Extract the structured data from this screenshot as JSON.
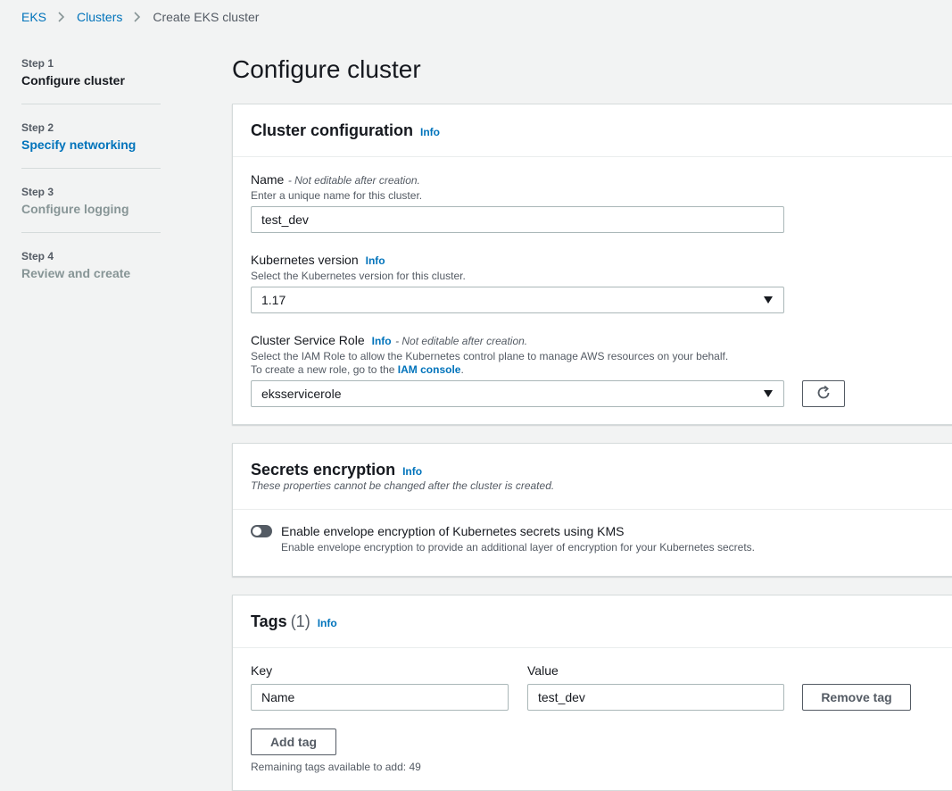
{
  "breadcrumb": {
    "items": [
      "EKS",
      "Clusters"
    ],
    "current": "Create EKS cluster"
  },
  "steps": [
    {
      "step": "Step 1",
      "title": "Configure cluster"
    },
    {
      "step": "Step 2",
      "title": "Specify networking"
    },
    {
      "step": "Step 3",
      "title": "Configure logging"
    },
    {
      "step": "Step 4",
      "title": "Review and create"
    }
  ],
  "page_title": "Configure cluster",
  "cluster_config": {
    "title": "Cluster configuration",
    "info": "Info",
    "name_label": "Name",
    "name_note": "- Not editable after creation.",
    "name_desc": "Enter a unique name for this cluster.",
    "name_value": "test_dev",
    "version_label": "Kubernetes version",
    "version_info": "Info",
    "version_desc": "Select the Kubernetes version for this cluster.",
    "version_value": "1.17",
    "role_label": "Cluster Service Role",
    "role_info": "Info",
    "role_note": "- Not editable after creation.",
    "role_desc1": "Select the IAM Role to allow the Kubernetes control plane to manage AWS resources on your behalf.",
    "role_desc2_prefix": "To create a new role, go to the",
    "role_desc2_link": "IAM console",
    "role_desc2_suffix": ".",
    "role_value": "eksservicerole"
  },
  "secrets": {
    "title": "Secrets encryption",
    "info": "Info",
    "subtitle": "These properties cannot be changed after the cluster is created.",
    "toggle_label": "Enable envelope encryption of Kubernetes secrets using KMS",
    "toggle_desc": "Enable envelope encryption to provide an additional layer of encryption for your Kubernetes secrets."
  },
  "tags": {
    "title": "Tags",
    "count": "(1)",
    "info": "Info",
    "key_label": "Key",
    "value_label": "Value",
    "key_value": "Name",
    "value_value": "test_dev",
    "remove_label": "Remove tag",
    "add_label": "Add tag",
    "remaining": "Remaining tags available to add: 49"
  }
}
